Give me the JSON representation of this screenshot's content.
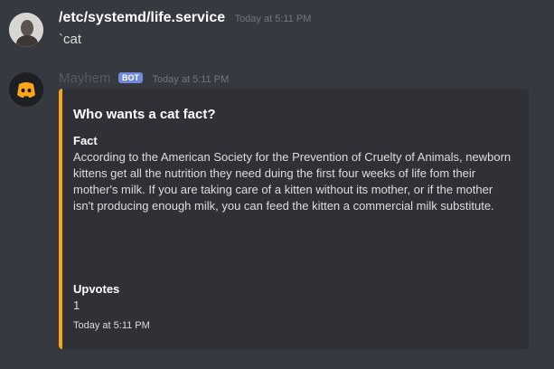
{
  "messages": [
    {
      "username": "/etc/systemd/life.service",
      "timestamp": "Today at 5:11 PM",
      "text": "`cat"
    },
    {
      "username": "Mayhem",
      "bot_tag": "BOT",
      "timestamp": "Today at 5:11 PM",
      "embed": {
        "accent_color": "#faa61a",
        "title": "Who wants a cat fact?",
        "fields": [
          {
            "name": "Fact",
            "value": "According to the American Society for the Prevention of Cruelty of Animals, newborn kittens get all the nutrition they need duing the first four weeks of life fom their mother's milk. If you are taking care of a kitten without its mother, or if the mother isn't producing enough milk, you can feed the kitten a commercial milk substitute."
          },
          {
            "name": "Upvotes",
            "value": "1"
          }
        ],
        "footer": "Today at 5:11 PM"
      }
    }
  ]
}
